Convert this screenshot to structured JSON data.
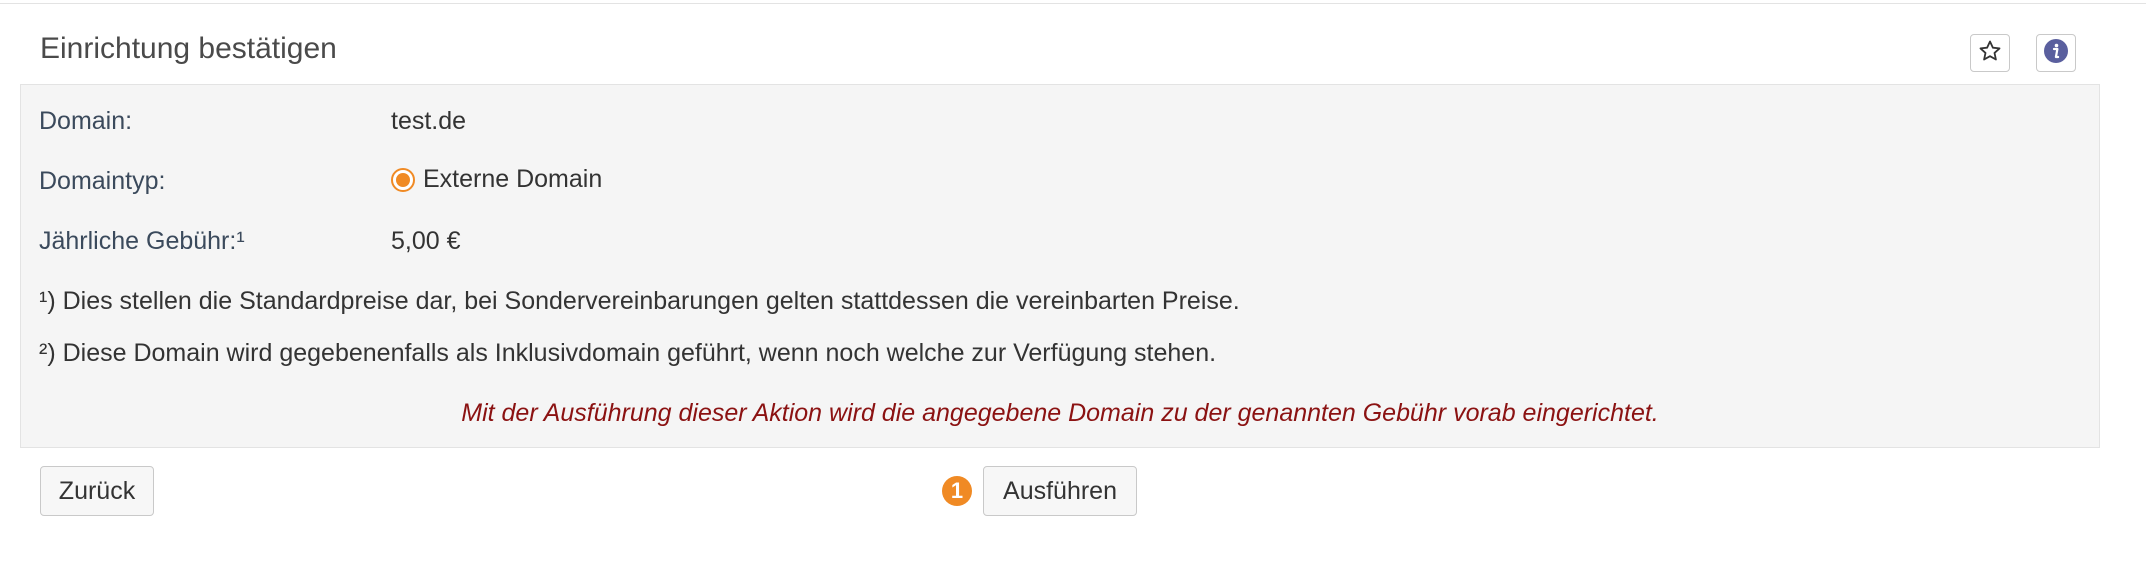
{
  "page": {
    "title": "Einrichtung bestätigen"
  },
  "header_icons": [
    {
      "icon": "star-icon"
    },
    {
      "icon": "info-icon"
    }
  ],
  "details": {
    "domain_label": "Domain:",
    "domain_value": "test.de",
    "type_label": "Domaintyp:",
    "type_value": "Externe Domain",
    "fee_label": "Jährliche Gebühr:¹",
    "fee_value": "5,00 €"
  },
  "notes": {
    "note1": "¹) Dies stellen die Standardpreise dar, bei Sondervereinbarungen gelten stattdessen die vereinbarten Preise.",
    "note2": "²) Diese Domain wird gegebenenfalls als Inklusivdomain geführt, wenn noch welche zur Verfügung stehen."
  },
  "warning": "Mit der Ausführung dieser Aktion wird die angegebene Domain zu der genannten Gebühr vorab eingerichtet.",
  "actions": {
    "back_label": "Zurück",
    "step_number": "1",
    "execute_label": "Ausführen"
  },
  "colors": {
    "accent": "#f08a24",
    "warning_text": "#8b1212",
    "info_icon": "#5a5f9e"
  }
}
